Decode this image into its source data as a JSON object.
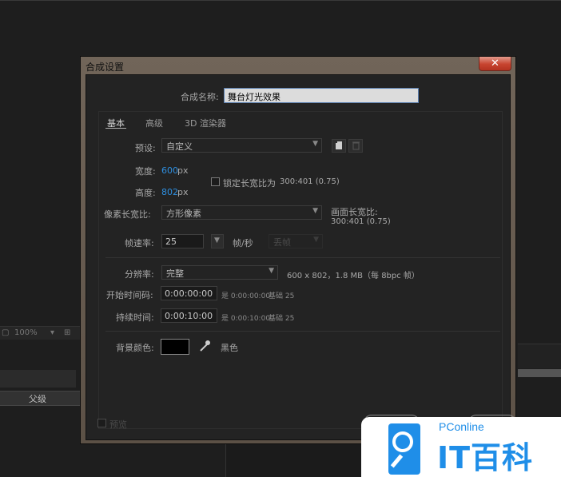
{
  "background": {
    "zoom": "100%",
    "parent_column": "父级"
  },
  "dialog": {
    "title": "合成设置",
    "close_label": "✕",
    "name_label": "合成名称:",
    "name_value": "舞台灯光效果",
    "tabs": [
      {
        "label": "基本",
        "active": true
      },
      {
        "label": "高级",
        "active": false
      },
      {
        "label": "3D 渲染器",
        "active": false
      }
    ],
    "preset": {
      "label": "预设:",
      "value": "自定义"
    },
    "width": {
      "label": "宽度:",
      "value": "600",
      "unit": "px"
    },
    "height": {
      "label": "高度:",
      "value": "802",
      "unit": "px"
    },
    "lock_aspect": {
      "label": "锁定长宽比为",
      "ratio": "300:401 (0.75)",
      "checked": false
    },
    "pixel_aspect": {
      "label": "像素长宽比:",
      "value": "方形像素"
    },
    "frame_aspect": {
      "label": "画面长宽比:",
      "value": "300:401 (0.75)"
    },
    "frame_rate": {
      "label": "帧速率:",
      "value": "25",
      "unit": "帧/秒",
      "drop_frame": "丢帧"
    },
    "resolution": {
      "label": "分辨率:",
      "value": "完整",
      "info": "600 x 802，1.8 MB（每 8bpc 帧）"
    },
    "start_timecode": {
      "label": "开始时间码:",
      "value": "0:00:00:00",
      "equals": "是 0:00:00:00",
      "base": "基础 25"
    },
    "duration": {
      "label": "持续时间:",
      "value": "0:00:10:00",
      "equals": "是 0:00:10:00",
      "base": "基础 25"
    },
    "bg_color": {
      "label": "背景颜色:",
      "name": "黑色",
      "hex": "#000000"
    },
    "preview": {
      "label": "预览"
    }
  },
  "watermark": {
    "small": "PConline",
    "big": "IT百科"
  },
  "colors": {
    "accent": "#2e8fe0",
    "watermark": "#1f8ee8"
  }
}
